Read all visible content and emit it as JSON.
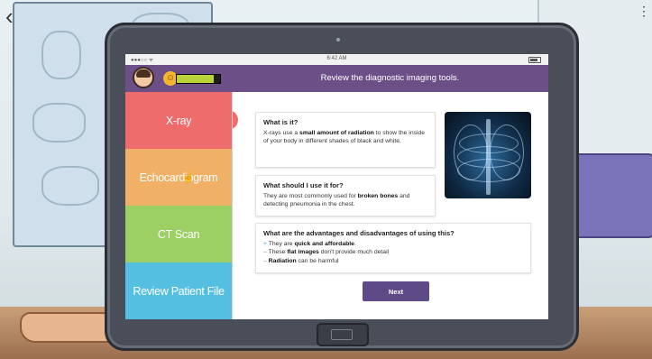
{
  "nav": {
    "back_icon": "chevron-left-icon"
  },
  "statusbar": {
    "signal": "●●●○○ ᯤ",
    "time": "6:42 AM"
  },
  "header": {
    "title": "Review the diagnostic imaging tools.",
    "mood_icon": "smiley-icon",
    "progress_fraction": 0.85
  },
  "menu": {
    "items": [
      {
        "label": "X-ray",
        "color": "#ef6c6d",
        "active": true
      },
      {
        "label": "Echocardiogram",
        "color": "#f0b065",
        "active": false
      },
      {
        "label": "CT Scan",
        "color": "#9ccf64",
        "active": false
      },
      {
        "label": "Review Patient File",
        "color": "#55bfe2",
        "active": false
      }
    ]
  },
  "content": {
    "what": {
      "heading": "What is it?",
      "t1": "X-rays use a ",
      "b1": "small amount of radiation",
      "t2": " to show the inside of your body in different shades of black and white."
    },
    "use": {
      "heading": "What should I use it for?",
      "t1": "They are most commonly used for ",
      "b1": "broken bones",
      "t2": " and detecting pneumonia in the chest."
    },
    "adv": {
      "heading": "What are the advantages and disadvantages of using this?",
      "plus": "+",
      "l1a": "They are ",
      "l1b": "quick and affordable",
      "l1c": ".",
      "minus": "–",
      "l2a": "These ",
      "l2b": "flat images",
      "l2c": " don't provide much detail",
      "l3b": "Radiation",
      "l3c": " can be harmful"
    }
  },
  "buttons": {
    "next": "Next"
  },
  "colors": {
    "header": "#6b4f86",
    "next_button": "#5e4a86"
  }
}
